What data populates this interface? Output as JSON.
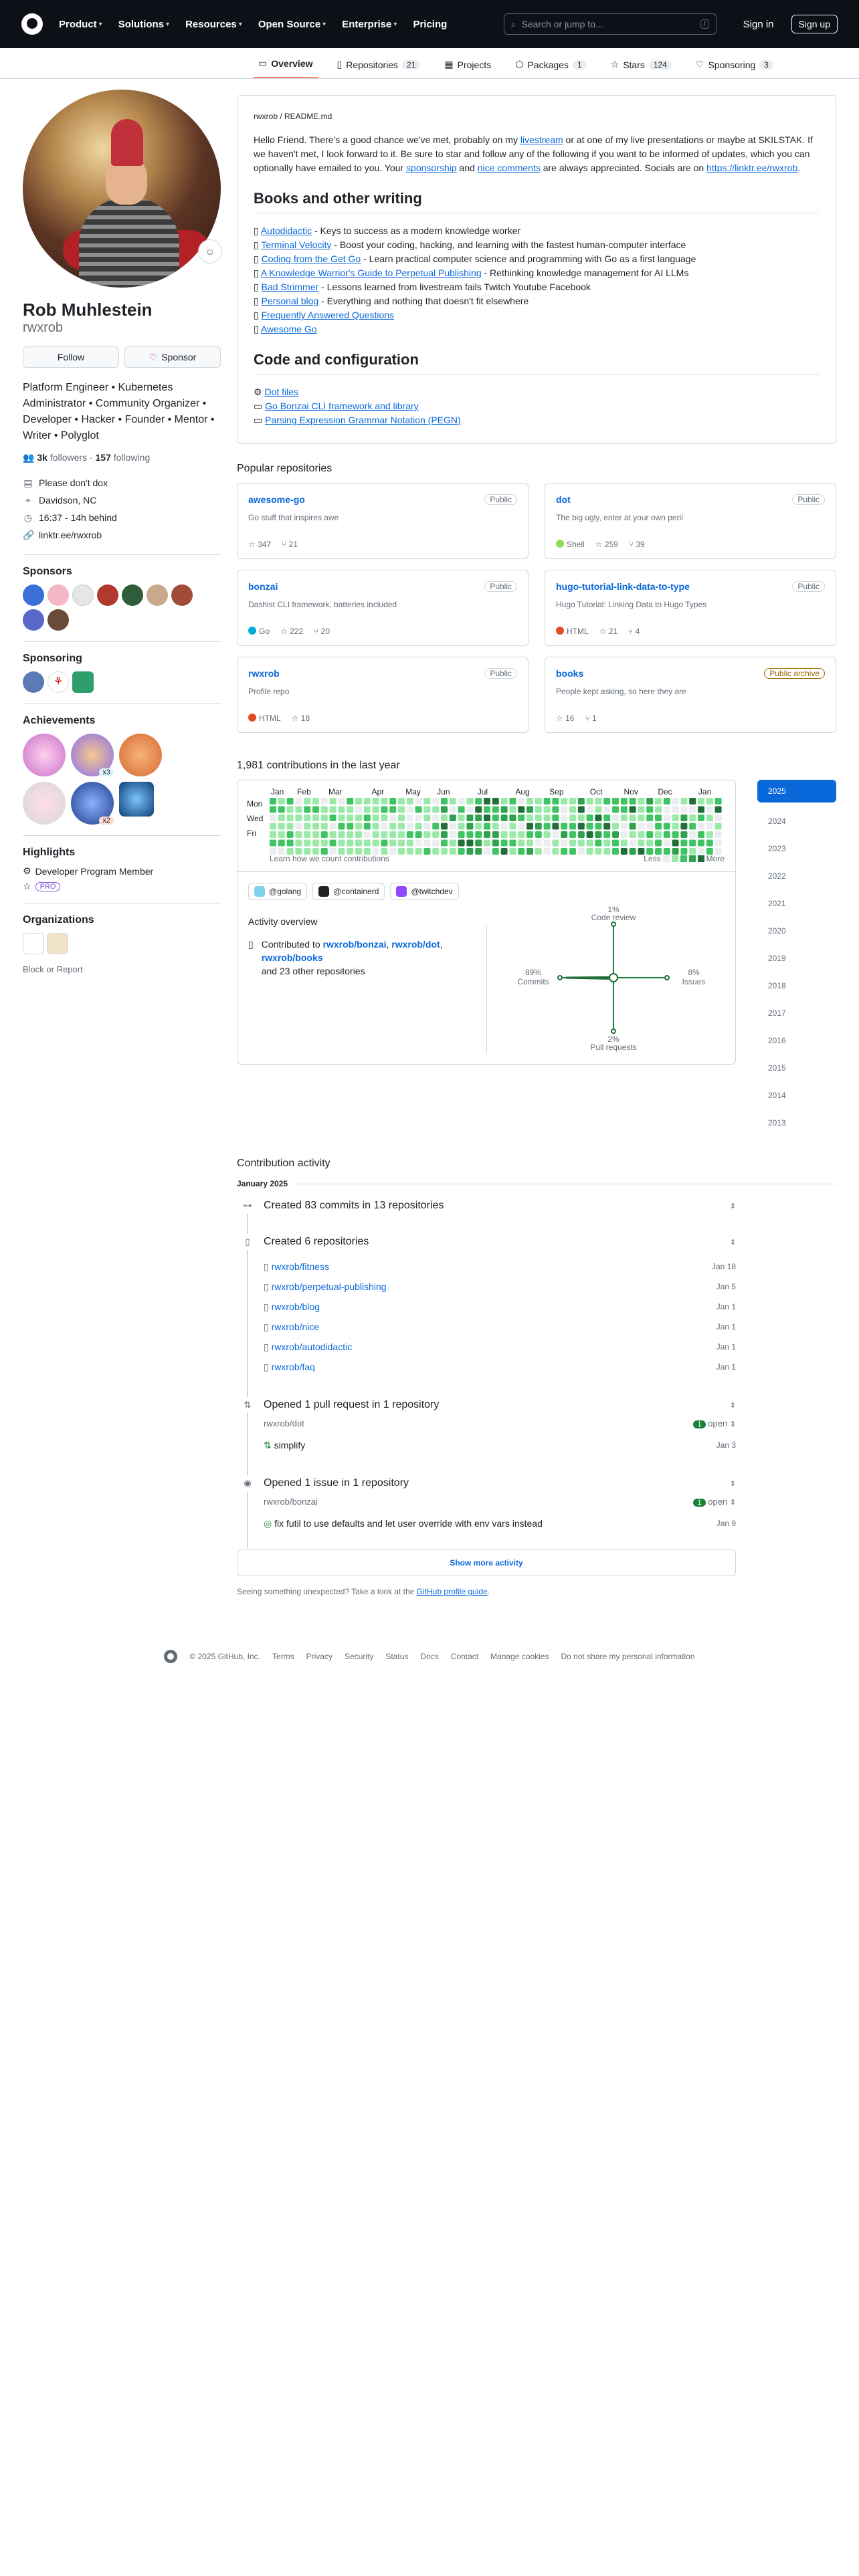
{
  "nav": {
    "items": [
      "Product",
      "Solutions",
      "Resources",
      "Open Source",
      "Enterprise",
      "Pricing"
    ],
    "search_placeholder": "Search or jump to...",
    "slash": "/",
    "signin": "Sign in",
    "signup": "Sign up"
  },
  "tabs": [
    {
      "label": "Overview",
      "count": ""
    },
    {
      "label": "Repositories",
      "count": "21"
    },
    {
      "label": "Projects",
      "count": ""
    },
    {
      "label": "Packages",
      "count": "1"
    },
    {
      "label": "Stars",
      "count": "124"
    },
    {
      "label": "Sponsoring",
      "count": "3"
    }
  ],
  "profile": {
    "name": "Rob Muhlestein",
    "login": "rwxrob",
    "follow_btn": "Follow",
    "sponsor_btn": "Sponsor",
    "bio": "Platform Engineer • Kubernetes Administrator • Community Organizer • Developer • Hacker • Founder • Mentor • Writer • Polyglot",
    "followers": "3k",
    "followers_label": "followers",
    "following": "157",
    "following_label": "following",
    "facts": [
      "Please don't dox",
      "Davidson, NC",
      "16:37 - 14h behind",
      "linktr.ee/rwxrob"
    ]
  },
  "sections": {
    "sponsors": "Sponsors",
    "sponsoring": "Sponsoring",
    "achievements": "Achievements",
    "highlights": "Highlights",
    "organizations": "Organizations"
  },
  "highlights": {
    "member": "Developer Program Member",
    "pro": "PRO"
  },
  "block": "Block or Report",
  "readme": {
    "path": "rwxrob / README.md",
    "intro_1": "Hello Friend. There's a good chance we've met, probably on my ",
    "livestream": "livestream",
    "intro_2": " or at one of my live presentations or maybe at SKILSTAK. If we haven't met, I look forward to it. Be sure to star and follow any of the following if you want to be informed of updates, which you can optionally have emailed to you. Your ",
    "sponsorship": "sponsorship",
    "and": " and ",
    "nice": "nice comments",
    "intro_3": " are always appreciated. Socials are on ",
    "link": "https://linktr.ee/rwxrob",
    "dot": ".",
    "h_books": "Books and other writing",
    "books": [
      {
        "link": "Autodidactic",
        "rest": " - Keys to success as a modern knowledge worker"
      },
      {
        "link": "Terminal Velocity",
        "rest": " - Boost your coding, hacking, and learning with the fastest human-computer interface"
      },
      {
        "link": "Coding from the Get Go",
        "rest": " - Learn practical computer science and programming with Go as a first language"
      },
      {
        "link": "A Knowledge Warrior's Guide to Perpetual Publishing",
        "rest": " - Rethinking knowledge management for AI LLMs"
      },
      {
        "link": "Bad Strimmer",
        "rest": " - Lessons learned from livestream fails Twitch Youtube Facebook"
      },
      {
        "link": "Personal blog",
        "rest": " - Everything and nothing that doesn't fit elsewhere"
      },
      {
        "link": "Frequently Answered Questions",
        "rest": ""
      },
      {
        "link": "Awesome Go",
        "rest": ""
      }
    ],
    "h_code": "Code and configuration",
    "code": [
      "Dot files",
      "Go Bonzai CLI framework and library",
      "Parsing Expression Grammar Notation (PEGN)"
    ]
  },
  "popular_title": "Popular repositories",
  "pins": [
    {
      "name": "awesome-go",
      "vis": "Public",
      "desc": "Go stuff that inspires awe",
      "lang": "",
      "color": "",
      "stars": "347",
      "forks": "21"
    },
    {
      "name": "dot",
      "vis": "Public",
      "desc": "The big ugly, enter at your own peril",
      "lang": "Shell",
      "color": "#89e051",
      "stars": "259",
      "forks": "39"
    },
    {
      "name": "bonzai",
      "vis": "Public",
      "desc": "Dashist CLI framework, batteries included",
      "lang": "Go",
      "color": "#00add8",
      "stars": "222",
      "forks": "20"
    },
    {
      "name": "hugo-tutorial-link-data-to-type",
      "vis": "Public",
      "desc": "Hugo Tutorial: Linking Data to Hugo Types",
      "lang": "HTML",
      "color": "#e34c26",
      "stars": "21",
      "forks": "4"
    },
    {
      "name": "rwxrob",
      "vis": "Public",
      "desc": "Profile repo",
      "lang": "HTML",
      "color": "#e34c26",
      "stars": "18",
      "forks": ""
    },
    {
      "name": "books",
      "vis": "Public archive",
      "desc": "People kept asking, so here they are",
      "lang": "",
      "color": "",
      "stars": "16",
      "forks": "1"
    }
  ],
  "contrib": {
    "title": "1,981 contributions in the last year",
    "months": [
      "Jan",
      "Feb",
      "Mar",
      "Apr",
      "May",
      "Jun",
      "Jul",
      "Aug",
      "Sep",
      "Oct",
      "Nov",
      "Dec",
      "Jan"
    ],
    "days": [
      "Mon",
      "Wed",
      "Fri"
    ],
    "learn": "Learn how we count contributions",
    "less": "Less",
    "more": "More",
    "years": [
      "2025",
      "2024",
      "2023",
      "2022",
      "2021",
      "2020",
      "2019",
      "2018",
      "2017",
      "2016",
      "2015",
      "2014",
      "2013"
    ]
  },
  "activity": {
    "orgs": [
      "@golang",
      "@containerd",
      "@twitchdev"
    ],
    "overview": "Activity overview",
    "contributed": "Contributed to ",
    "r1": "rwxrob/bonzai",
    "r2": "rwxrob/dot",
    "r3": "rwxrob/books",
    "others": "and 23 other repositories",
    "axes": {
      "top_pct": "1%",
      "top": "Code review",
      "left_pct": "89%",
      "left": "Commits",
      "right_pct": "8%",
      "right": "Issues",
      "bottom_pct": "2%",
      "bottom": "Pull requests"
    }
  },
  "chart_data": {
    "type": "heatmap",
    "title": "1,981 contributions in the last year",
    "total": 1981,
    "axes": {
      "code_review": 1,
      "commits": 89,
      "issues": 8,
      "pull_requests": 2
    }
  },
  "ca": {
    "title": "Contribution activity",
    "month": "January 2025",
    "commits": "Created 83 commits in 13 repositories",
    "created": "Created 6 repositories",
    "repos": [
      {
        "name": "rwxrob/fitness",
        "date": "Jan 18"
      },
      {
        "name": "rwxrob/perpetual-publishing",
        "date": "Jan 5"
      },
      {
        "name": "rwxrob/blog",
        "date": "Jan 1"
      },
      {
        "name": "rwxrob/nice",
        "date": "Jan 1"
      },
      {
        "name": "rwxrob/autodidactic",
        "date": "Jan 1"
      },
      {
        "name": "rwxrob/faq",
        "date": "Jan 1"
      }
    ],
    "pr_title": "Opened 1 pull request in 1 repository",
    "pr_repo": "rwxrob/dot",
    "pr_count": "1",
    "pr_open": "open",
    "pr_name": "simplify",
    "pr_date": "Jan 3",
    "is_title": "Opened 1 issue in 1 repository",
    "is_repo": "rwxrob/bonzai",
    "is_count": "1",
    "is_open": "open",
    "is_name": "fix futil to use defaults and let user override with env vars instead",
    "is_date": "Jan 9",
    "more": "Show more activity",
    "foot1": "Seeing something unexpected? Take a look at the ",
    "foot_link": "GitHub profile guide",
    "foot_end": "."
  },
  "footer": [
    "© 2025 GitHub, Inc.",
    "Terms",
    "Privacy",
    "Security",
    "Status",
    "Docs",
    "Contact",
    "Manage cookies",
    "Do not share my personal information"
  ]
}
